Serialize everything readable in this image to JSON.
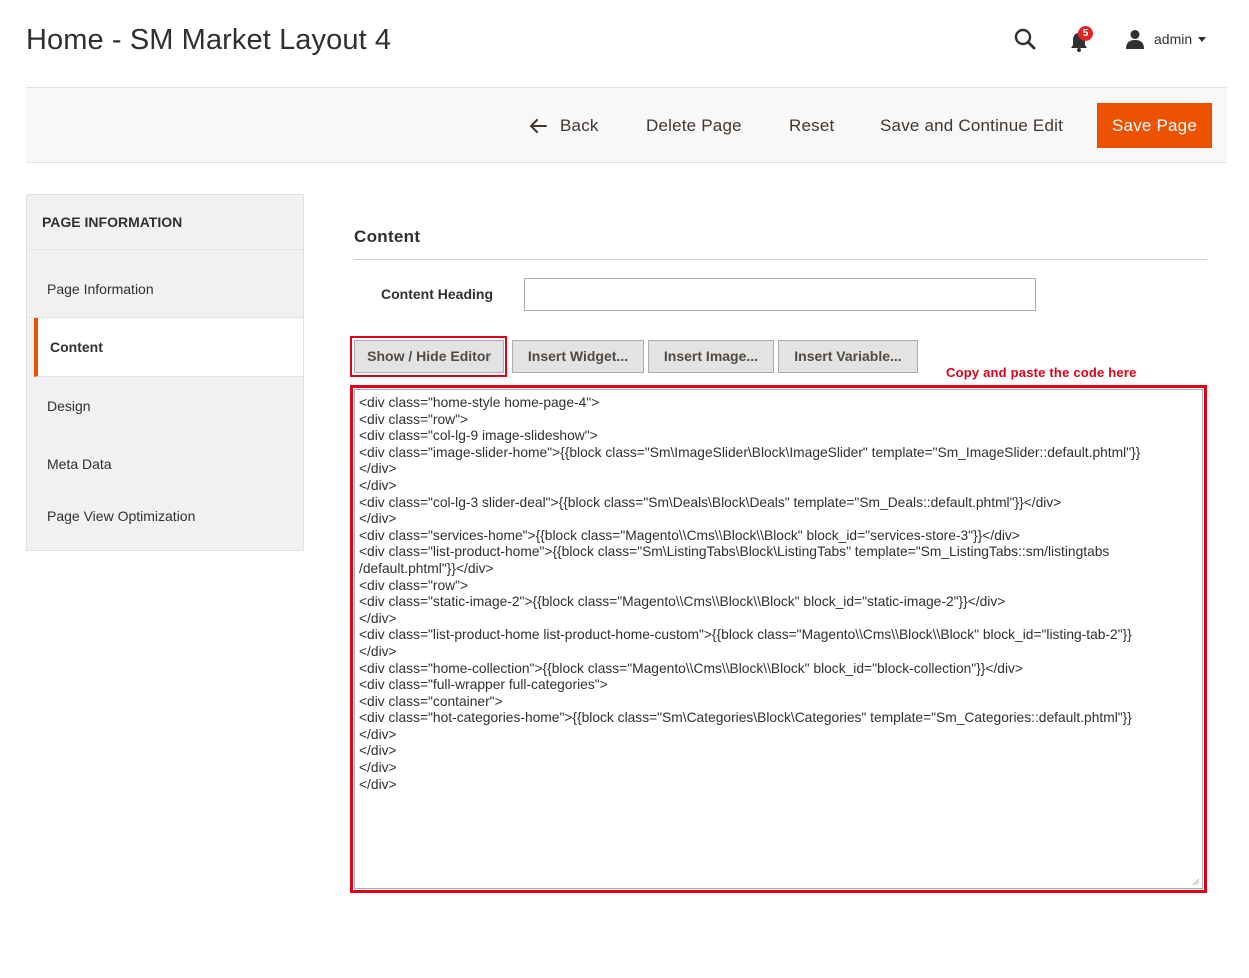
{
  "header": {
    "title": "Home - SM Market Layout 4",
    "notifications_count": "5",
    "user_name": "admin"
  },
  "toolbar": {
    "back_label": "Back",
    "delete_label": "Delete Page",
    "reset_label": "Reset",
    "save_continue_label": "Save and Continue Edit",
    "save_label": "Save Page"
  },
  "sidebar": {
    "title": "PAGE INFORMATION",
    "items": [
      {
        "label": "Page Information",
        "active": false
      },
      {
        "label": "Content",
        "active": true
      },
      {
        "label": "Design",
        "active": false
      },
      {
        "label": "Meta Data",
        "active": false
      },
      {
        "label": "Page View Optimization",
        "active": false
      }
    ]
  },
  "content": {
    "section_title": "Content",
    "heading_label": "Content Heading",
    "heading_value": "",
    "buttons": {
      "show_hide": "Show / Hide Editor",
      "insert_widget": "Insert Widget...",
      "insert_image": "Insert Image...",
      "insert_variable": "Insert Variable..."
    },
    "annotation": "Copy and paste the code here",
    "code_lines": [
      "<div class=\"home-style home-page-4\">",
      "<div class=\"row\">",
      "<div class=\"col-lg-9 image-slideshow\">",
      "<div class=\"image-slider-home\">{{block class=\"Sm\\ImageSlider\\Block\\ImageSlider\" template=\"Sm_ImageSlider::default.phtml\"}}",
      "</div>",
      "</div>",
      "<div class=\"col-lg-3 slider-deal\">{{block class=\"Sm\\Deals\\Block\\Deals\" template=\"Sm_Deals::default.phtml\"}}</div>",
      "</div>",
      "<div class=\"services-home\">{{block class=\"Magento\\\\Cms\\\\Block\\\\Block\" block_id=\"services-store-3\"}}</div>",
      "<div class=\"list-product-home\">{{block class=\"Sm\\ListingTabs\\Block\\ListingTabs\" template=\"Sm_ListingTabs::sm/listingtabs",
      "/default.phtml\"}}</div>",
      "<div class=\"row\">",
      "<div class=\"static-image-2\">{{block class=\"Magento\\\\Cms\\\\Block\\\\Block\" block_id=\"static-image-2\"}}</div>",
      "</div>",
      "<div class=\"list-product-home list-product-home-custom\">{{block class=\"Magento\\\\Cms\\\\Block\\\\Block\" block_id=\"listing-tab-2\"}}",
      "</div>",
      "<div class=\"home-collection\">{{block class=\"Magento\\\\Cms\\\\Block\\\\Block\" block_id=\"block-collection\"}}</div>",
      "<div class=\"full-wrapper full-categories\">",
      "<div class=\"container\">",
      "<div class=\"hot-categories-home\">{{block class=\"Sm\\Categories\\Block\\Categories\" template=\"Sm_Categories::default.phtml\"}}",
      "</div>",
      "</div>",
      "</div>",
      "</div>"
    ]
  },
  "icons": {
    "search": "search-icon",
    "notifications": "bell-icon",
    "user": "user-icon",
    "back": "arrow-left-icon"
  },
  "colors": {
    "accent": "#eb5202",
    "highlight": "#e0001a",
    "toolbar_bg": "#f8f8f8",
    "sidebar_bg": "#f1f1f1"
  }
}
